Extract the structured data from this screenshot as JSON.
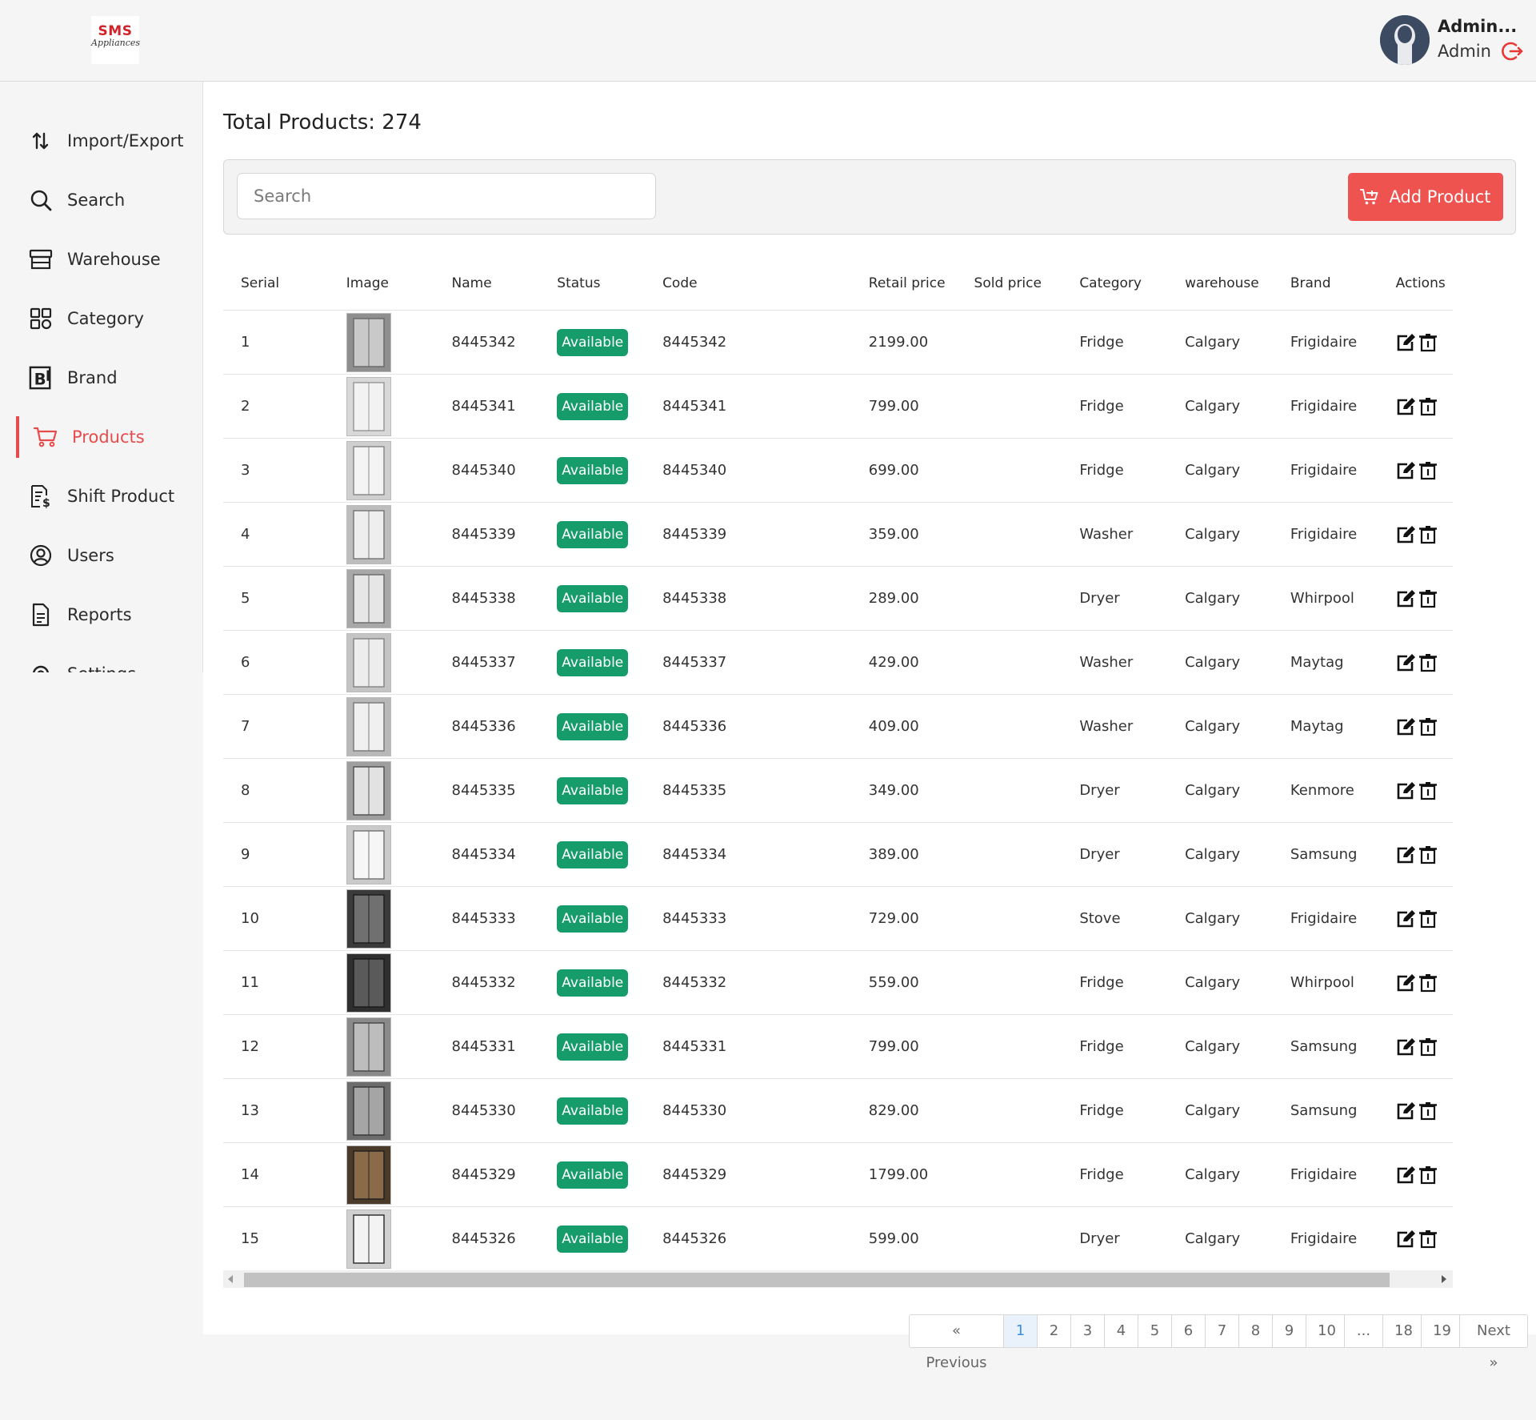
{
  "header": {
    "logo_top": "SMS",
    "logo_sub": "Appliances",
    "user_name": "Admin...",
    "user_role": "Admin"
  },
  "sidebar": {
    "items": [
      {
        "label": "Import/Export",
        "icon": "import-export-icon"
      },
      {
        "label": "Search",
        "icon": "search-icon"
      },
      {
        "label": "Warehouse",
        "icon": "warehouse-icon"
      },
      {
        "label": "Category",
        "icon": "category-grid-icon"
      },
      {
        "label": "Brand",
        "icon": "brand-icon"
      },
      {
        "label": "Products",
        "icon": "cart-icon",
        "active": true
      },
      {
        "label": "Shift Product",
        "icon": "shift-product-icon"
      },
      {
        "label": "Users",
        "icon": "user-circle-icon"
      },
      {
        "label": "Reports",
        "icon": "report-icon"
      },
      {
        "label": "Settings",
        "icon": "gear-icon"
      }
    ]
  },
  "main": {
    "title": "Total Products: 274",
    "search_placeholder": "Search",
    "add_button": "Add Product"
  },
  "table": {
    "columns": [
      "Serial",
      "Image",
      "Name",
      "Status",
      "Code",
      "Retail price",
      "Sold price",
      "Category",
      "warehouse",
      "Brand",
      "Actions"
    ],
    "rows": [
      {
        "serial": "1",
        "name": "8445342",
        "status": "Available",
        "code": "8445342",
        "retail": "2199.00",
        "sold": "",
        "category": "Fridge",
        "warehouse": "Calgary",
        "brand": "Frigidaire"
      },
      {
        "serial": "2",
        "name": "8445341",
        "status": "Available",
        "code": "8445341",
        "retail": "799.00",
        "sold": "",
        "category": "Fridge",
        "warehouse": "Calgary",
        "brand": "Frigidaire"
      },
      {
        "serial": "3",
        "name": "8445340",
        "status": "Available",
        "code": "8445340",
        "retail": "699.00",
        "sold": "",
        "category": "Fridge",
        "warehouse": "Calgary",
        "brand": "Frigidaire"
      },
      {
        "serial": "4",
        "name": "8445339",
        "status": "Available",
        "code": "8445339",
        "retail": "359.00",
        "sold": "",
        "category": "Washer",
        "warehouse": "Calgary",
        "brand": "Frigidaire"
      },
      {
        "serial": "5",
        "name": "8445338",
        "status": "Available",
        "code": "8445338",
        "retail": "289.00",
        "sold": "",
        "category": "Dryer",
        "warehouse": "Calgary",
        "brand": "Whirpool"
      },
      {
        "serial": "6",
        "name": "8445337",
        "status": "Available",
        "code": "8445337",
        "retail": "429.00",
        "sold": "",
        "category": "Washer",
        "warehouse": "Calgary",
        "brand": "Maytag"
      },
      {
        "serial": "7",
        "name": "8445336",
        "status": "Available",
        "code": "8445336",
        "retail": "409.00",
        "sold": "",
        "category": "Washer",
        "warehouse": "Calgary",
        "brand": "Maytag"
      },
      {
        "serial": "8",
        "name": "8445335",
        "status": "Available",
        "code": "8445335",
        "retail": "349.00",
        "sold": "",
        "category": "Dryer",
        "warehouse": "Calgary",
        "brand": "Kenmore"
      },
      {
        "serial": "9",
        "name": "8445334",
        "status": "Available",
        "code": "8445334",
        "retail": "389.00",
        "sold": "",
        "category": "Dryer",
        "warehouse": "Calgary",
        "brand": "Samsung"
      },
      {
        "serial": "10",
        "name": "8445333",
        "status": "Available",
        "code": "8445333",
        "retail": "729.00",
        "sold": "",
        "category": "Stove",
        "warehouse": "Calgary",
        "brand": "Frigidaire"
      },
      {
        "serial": "11",
        "name": "8445332",
        "status": "Available",
        "code": "8445332",
        "retail": "559.00",
        "sold": "",
        "category": "Fridge",
        "warehouse": "Calgary",
        "brand": "Whirpool"
      },
      {
        "serial": "12",
        "name": "8445331",
        "status": "Available",
        "code": "8445331",
        "retail": "799.00",
        "sold": "",
        "category": "Fridge",
        "warehouse": "Calgary",
        "brand": "Samsung"
      },
      {
        "serial": "13",
        "name": "8445330",
        "status": "Available",
        "code": "8445330",
        "retail": "829.00",
        "sold": "",
        "category": "Fridge",
        "warehouse": "Calgary",
        "brand": "Samsung"
      },
      {
        "serial": "14",
        "name": "8445329",
        "status": "Available",
        "code": "8445329",
        "retail": "1799.00",
        "sold": "",
        "category": "Fridge",
        "warehouse": "Calgary",
        "brand": "Frigidaire"
      },
      {
        "serial": "15",
        "name": "8445326",
        "status": "Available",
        "code": "8445326",
        "retail": "599.00",
        "sold": "",
        "category": "Dryer",
        "warehouse": "Calgary",
        "brand": "Frigidaire"
      }
    ]
  },
  "pagination": {
    "items": [
      "« Previous",
      "1",
      "2",
      "3",
      "4",
      "5",
      "6",
      "7",
      "8",
      "9",
      "10",
      "...",
      "18",
      "19",
      "Next »"
    ],
    "current": "1"
  },
  "colors": {
    "accent": "#ef5350",
    "status_available": "#169c6b",
    "page_current": "#3a8dde"
  }
}
